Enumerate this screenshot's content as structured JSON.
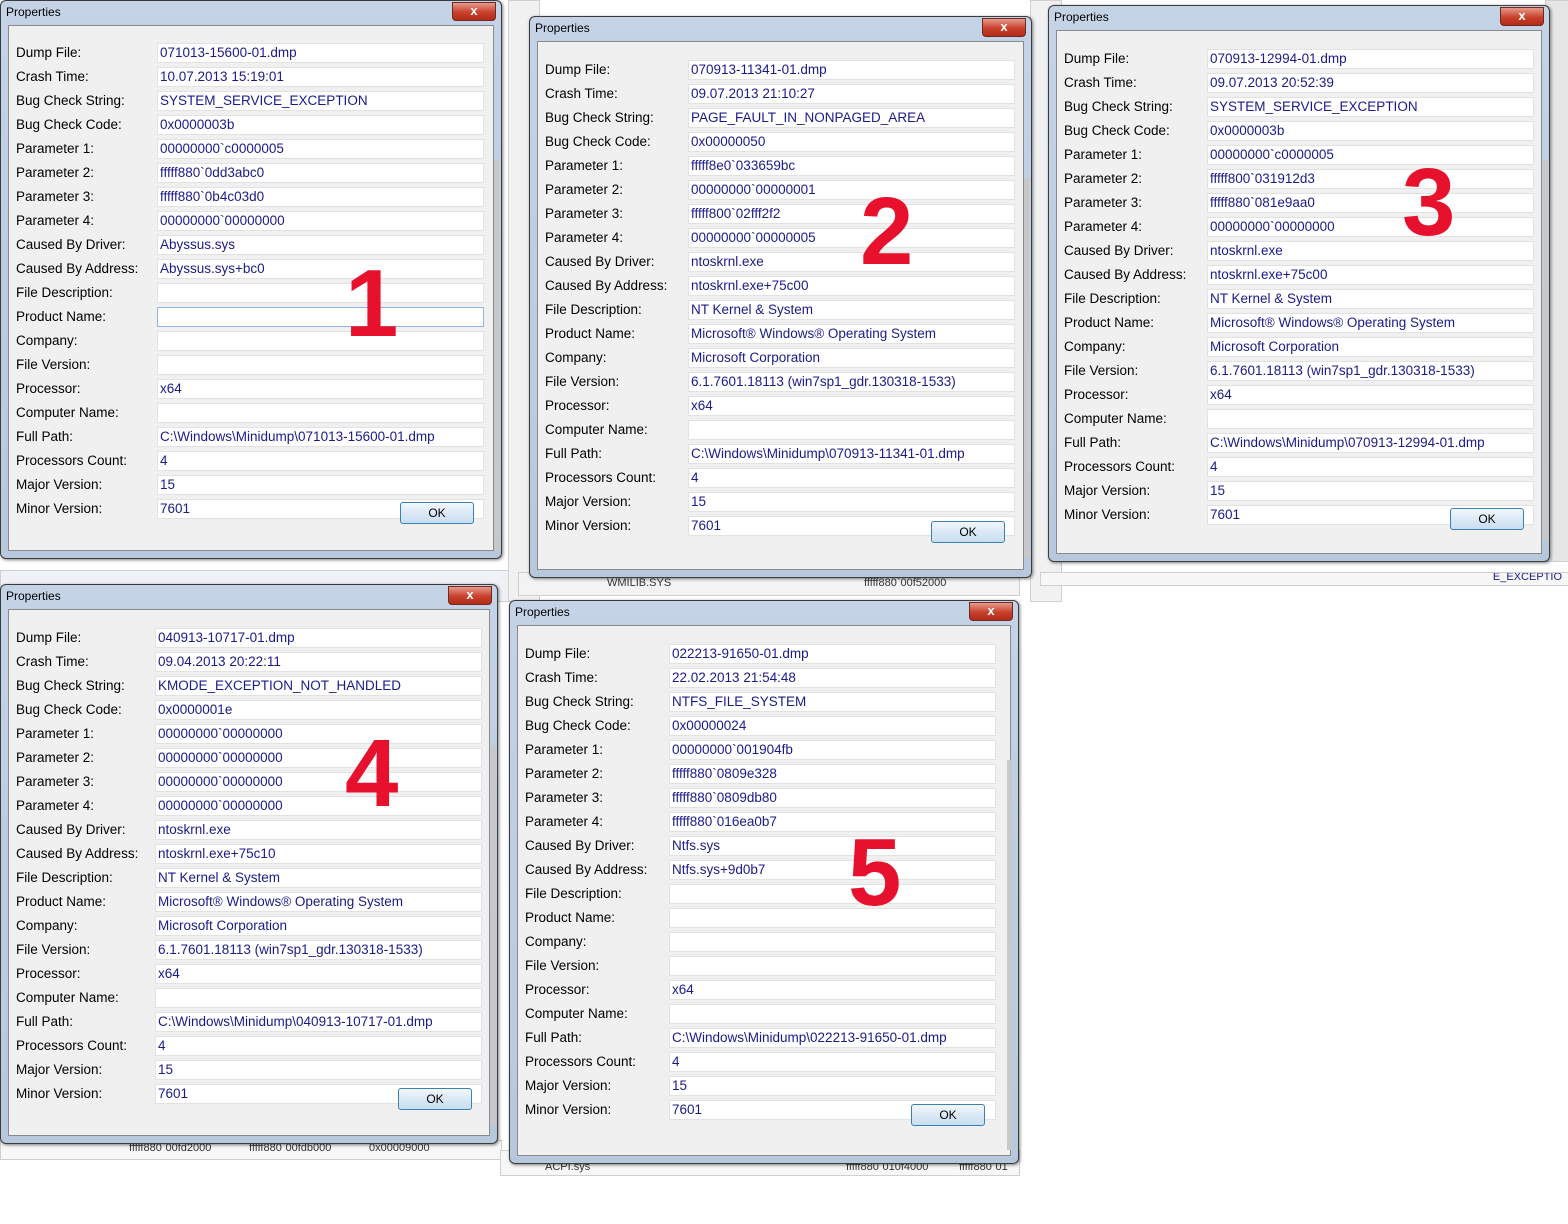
{
  "labels": [
    "Dump File:",
    "Crash Time:",
    "Bug Check String:",
    "Bug Check Code:",
    "Parameter 1:",
    "Parameter 2:",
    "Parameter 3:",
    "Parameter 4:",
    "Caused By Driver:",
    "Caused By Address:",
    "File Description:",
    "Product Name:",
    "Company:",
    "File Version:",
    "Processor:",
    "Computer Name:",
    "Full Path:",
    "Processors Count:",
    "Major Version:",
    "Minor Version:"
  ],
  "dialogs": [
    {
      "title": "Properties",
      "close": "x",
      "ok": "OK",
      "marker": "1",
      "values": [
        "071013-15600-01.dmp",
        "10.07.2013 15:19:01",
        "SYSTEM_SERVICE_EXCEPTION",
        "0x0000003b",
        "00000000`c0000005",
        "fffff880`0dd3abc0",
        "fffff880`0b4c03d0",
        "00000000`00000000",
        "Abyssus.sys",
        "Abyssus.sys+bc0",
        "",
        "",
        "",
        "",
        "x64",
        "",
        "C:\\Windows\\Minidump\\071013-15600-01.dmp",
        "4",
        "15",
        "7601"
      ]
    },
    {
      "title": "Properties",
      "close": "x",
      "ok": "OK",
      "marker": "2",
      "values": [
        "070913-11341-01.dmp",
        "09.07.2013 21:10:27",
        "PAGE_FAULT_IN_NONPAGED_AREA",
        "0x00000050",
        "fffff8e0`033659bc",
        "00000000`00000001",
        "fffff800`02fff2f2",
        "00000000`00000005",
        "ntoskrnl.exe",
        "ntoskrnl.exe+75c00",
        "NT Kernel & System",
        "Microsoft® Windows® Operating System",
        "Microsoft Corporation",
        "6.1.7601.18113 (win7sp1_gdr.130318-1533)",
        "x64",
        "",
        "C:\\Windows\\Minidump\\070913-11341-01.dmp",
        "4",
        "15",
        "7601"
      ]
    },
    {
      "title": "Properties",
      "close": "x",
      "ok": "OK",
      "marker": "3",
      "values": [
        "070913-12994-01.dmp",
        "09.07.2013 20:52:39",
        "SYSTEM_SERVICE_EXCEPTION",
        "0x0000003b",
        "00000000`c0000005",
        "fffff800`031912d3",
        "fffff880`081e9aa0",
        "00000000`00000000",
        "ntoskrnl.exe",
        "ntoskrnl.exe+75c00",
        "NT Kernel & System",
        "Microsoft® Windows® Operating System",
        "Microsoft Corporation",
        "6.1.7601.18113 (win7sp1_gdr.130318-1533)",
        "x64",
        "",
        "C:\\Windows\\Minidump\\070913-12994-01.dmp",
        "4",
        "15",
        "7601"
      ]
    },
    {
      "title": "Properties",
      "close": "x",
      "ok": "OK",
      "marker": "4",
      "values": [
        "040913-10717-01.dmp",
        "09.04.2013 20:22:11",
        "KMODE_EXCEPTION_NOT_HANDLED",
        "0x0000001e",
        "00000000`00000000",
        "00000000`00000000",
        "00000000`00000000",
        "00000000`00000000",
        "ntoskrnl.exe",
        "ntoskrnl.exe+75c10",
        "NT Kernel & System",
        "Microsoft® Windows® Operating System",
        "Microsoft Corporation",
        "6.1.7601.18113 (win7sp1_gdr.130318-1533)",
        "x64",
        "",
        "C:\\Windows\\Minidump\\040913-10717-01.dmp",
        "4",
        "15",
        "7601"
      ]
    },
    {
      "title": "Properties",
      "close": "x",
      "ok": "OK",
      "marker": "5",
      "values": [
        "022213-91650-01.dmp",
        "22.02.2013 21:54:48",
        "NTFS_FILE_SYSTEM",
        "0x00000024",
        "00000000`001904fb",
        "fffff880`0809e328",
        "fffff880`0809db80",
        "fffff880`016ea0b7",
        "Ntfs.sys",
        "Ntfs.sys+9d0b7",
        "",
        "",
        "",
        "",
        "x64",
        "",
        "C:\\Windows\\Minidump\\022213-91650-01.dmp",
        "4",
        "15",
        "7601"
      ]
    }
  ],
  "background": {
    "frag_a": "fffff880`00fd2000",
    "frag_b": "fffff880`00fdb000",
    "frag_c": "0x00009000",
    "frag_d": "ACPI.sys",
    "frag_e": "fffff880`010f4000",
    "frag_f": "fffff880`01",
    "frag_g": "fffff880`00f52000",
    "frag_h": "WMILIB.SYS",
    "frag_i": "E_EXCEPTIO"
  }
}
